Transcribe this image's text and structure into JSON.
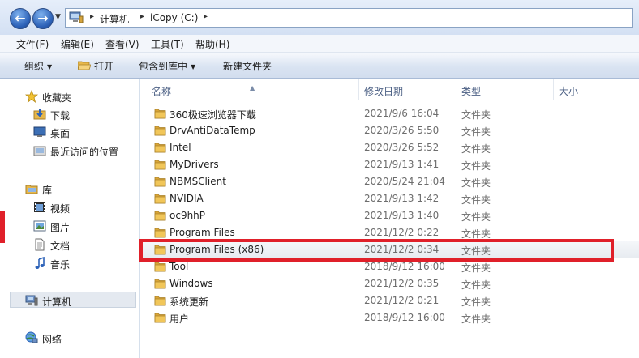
{
  "address": {
    "back_label": "←",
    "forward_label": "→",
    "separator": "▸",
    "crumbs": [
      "计算机",
      "iCopy (C:)"
    ]
  },
  "menu": [
    "文件(F)",
    "编辑(E)",
    "查看(V)",
    "工具(T)",
    "帮助(H)"
  ],
  "toolbar": {
    "organize": "组织",
    "open": "打开",
    "include_in_library": "包含到库中",
    "new_folder": "新建文件夹"
  },
  "nav": {
    "favorites": "收藏夹",
    "downloads": "下载",
    "desktop": "桌面",
    "recent": "最近访问的位置",
    "libraries": "库",
    "videos": "视频",
    "pictures": "图片",
    "documents": "文档",
    "music": "音乐",
    "computer": "计算机",
    "network": "网络"
  },
  "columns": {
    "name": "名称",
    "date": "修改日期",
    "type": "类型",
    "size": "大小"
  },
  "files": [
    {
      "name": "360极速浏览器下载",
      "date": "2021/9/6 16:04",
      "type": "文件夹"
    },
    {
      "name": "DrvAntiDataTemp",
      "date": "2020/3/26 5:50",
      "type": "文件夹"
    },
    {
      "name": "Intel",
      "date": "2020/3/26 5:52",
      "type": "文件夹"
    },
    {
      "name": "MyDrivers",
      "date": "2021/9/13 1:41",
      "type": "文件夹"
    },
    {
      "name": "NBMSClient",
      "date": "2020/5/24 21:04",
      "type": "文件夹"
    },
    {
      "name": "NVIDIA",
      "date": "2021/9/13 1:42",
      "type": "文件夹"
    },
    {
      "name": "oc9hhP",
      "date": "2021/9/13 1:40",
      "type": "文件夹"
    },
    {
      "name": "Program Files",
      "date": "2021/12/2 0:22",
      "type": "文件夹"
    },
    {
      "name": "Program Files (x86)",
      "date": "2021/12/2 0:34",
      "type": "文件夹"
    },
    {
      "name": "Tool",
      "date": "2018/9/12 16:00",
      "type": "文件夹"
    },
    {
      "name": "Windows",
      "date": "2021/12/2 0:35",
      "type": "文件夹"
    },
    {
      "name": "系统更新",
      "date": "2021/12/2 0:21",
      "type": "文件夹"
    },
    {
      "name": "用户",
      "date": "2018/9/12 16:00",
      "type": "文件夹"
    }
  ],
  "colors": {
    "annotation_red": "#e0202a",
    "folder_yellow": "#e8b84a"
  }
}
